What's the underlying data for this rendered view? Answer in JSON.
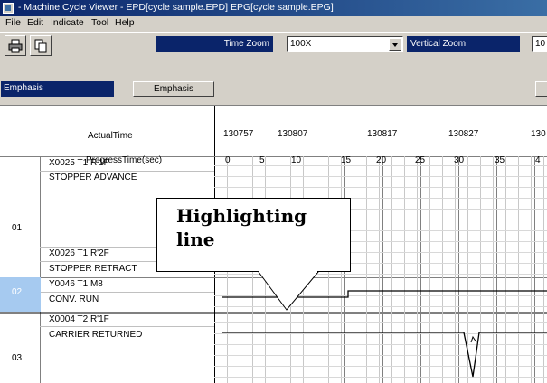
{
  "window": {
    "title": " - Machine Cycle Viewer - EPD[cycle sample.EPD]  EPG[cycle sample.EPG]"
  },
  "menu": [
    "File",
    "Edit",
    "Indicate",
    "Tool",
    "Help"
  ],
  "toolbar": {
    "time_zoom_label": "Time Zoom",
    "time_zoom_value": "100X",
    "vertical_zoom_label": "Vertical Zoom",
    "vertical_zoom_value": "10"
  },
  "emphasis": {
    "label": "Emphasis",
    "button": "Emphasis"
  },
  "timeline": {
    "actual_time_label": "ActualTime",
    "progress_time_label": "ProgressTime(sec)",
    "actual_times": [
      "130757",
      "130807",
      "130817",
      "130827",
      "130"
    ],
    "progress_ticks": [
      "0",
      "5",
      "10",
      "15",
      "20",
      "25",
      "30",
      "35",
      "4"
    ]
  },
  "groups": [
    {
      "number": "01",
      "signals": [
        "X0025 T1 R'1F",
        "STOPPER ADVANCE",
        "X0026 T1 R'2F",
        "STOPPER RETRACT"
      ]
    },
    {
      "number": "02",
      "signals": [
        "Y0046 T1 M8",
        "CONV. RUN"
      ]
    },
    {
      "number": "03",
      "signals": [
        "X0004 T2 R'1F",
        "CARRIER RETURNED"
      ]
    }
  ],
  "callout": {
    "text": "Highlighting line"
  },
  "colors": {
    "title_bar": "#0a246a",
    "label_bg": "#0a246a",
    "highlight_cell": "#a6caf0"
  }
}
